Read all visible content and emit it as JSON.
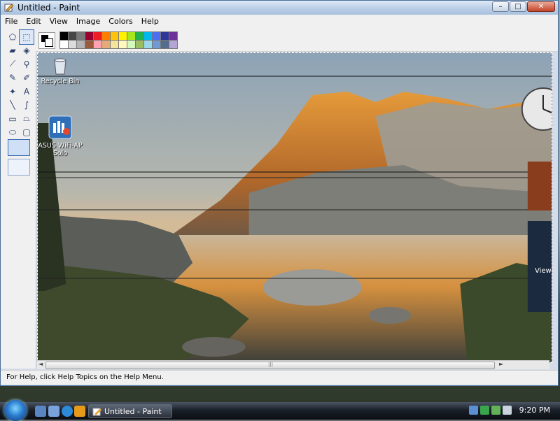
{
  "window": {
    "title": "Untitled - Paint",
    "buttons": {
      "minimize": "–",
      "maximize": "□",
      "close": "✕"
    }
  },
  "menu": [
    "File",
    "Edit",
    "View",
    "Image",
    "Colors",
    "Help"
  ],
  "tools": [
    {
      "name": "free-form-select-icon",
      "glyph": "⬠"
    },
    {
      "name": "rect-select-icon",
      "glyph": "⬚"
    },
    {
      "name": "eraser-icon",
      "glyph": "▰"
    },
    {
      "name": "fill-bucket-icon",
      "glyph": "◈"
    },
    {
      "name": "eyedropper-icon",
      "glyph": "⟋"
    },
    {
      "name": "magnifier-icon",
      "glyph": "⚲"
    },
    {
      "name": "pencil-icon",
      "glyph": "✎"
    },
    {
      "name": "brush-icon",
      "glyph": "✐"
    },
    {
      "name": "airbrush-icon",
      "glyph": "✦"
    },
    {
      "name": "text-icon",
      "glyph": "A"
    },
    {
      "name": "line-icon",
      "glyph": "╲"
    },
    {
      "name": "curve-icon",
      "glyph": "∫"
    },
    {
      "name": "rectangle-icon",
      "glyph": "▭"
    },
    {
      "name": "polygon-icon",
      "glyph": "⏢"
    },
    {
      "name": "ellipse-icon",
      "glyph": "⬭"
    },
    {
      "name": "rounded-rect-icon",
      "glyph": "▢"
    }
  ],
  "palette": {
    "foreground": "#000000",
    "background": "#ffffff",
    "colors": [
      "#000000",
      "#464646",
      "#787878",
      "#990030",
      "#ed1c24",
      "#ff7e00",
      "#ffc20e",
      "#fff200",
      "#a8e61d",
      "#22b14c",
      "#00b7ef",
      "#4d6df3",
      "#2f3699",
      "#6f3198",
      "#ffffff",
      "#dcdcdc",
      "#b4b4b4",
      "#9c5a3c",
      "#ffa3b1",
      "#e5aa7a",
      "#f5e49c",
      "#fff9bd",
      "#d3f9bc",
      "#9dbb61",
      "#99d9ea",
      "#709ad1",
      "#546d8e",
      "#b5a5d5"
    ]
  },
  "desktop_icons": [
    {
      "label": "Recycle Bin",
      "icon": "recycle-bin-icon"
    },
    {
      "label": "ASUS WiFi-AP Solo",
      "icon": "wifi-ap-icon"
    }
  ],
  "overlay": {
    "side_panel_text": "View"
  },
  "status": {
    "text": "For Help, click Help Topics on the Help Menu."
  },
  "taskbar": {
    "task_label": "Untitled - Paint",
    "clock": "9:20 PM"
  }
}
